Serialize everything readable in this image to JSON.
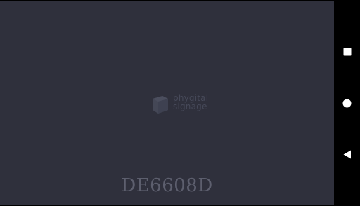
{
  "app": {
    "logo": {
      "line1": "phygital",
      "line2": "signage"
    },
    "device_code": "DE6608D",
    "background_color": "#2f303c"
  },
  "nav_bar": {
    "buttons": [
      {
        "name": "recents-button",
        "icon": "square-icon"
      },
      {
        "name": "home-button",
        "icon": "circle-icon"
      },
      {
        "name": "back-button",
        "icon": "triangle-left-icon"
      }
    ],
    "icon_color": "#ffffff"
  }
}
